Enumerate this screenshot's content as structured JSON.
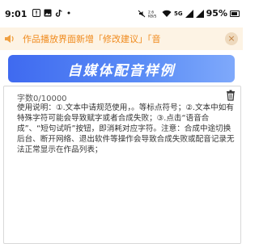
{
  "status_bar": {
    "time": "9:01",
    "left_icons": [
      "warning-icon",
      "image-icon",
      "tiktok-icon",
      "dot-icon"
    ],
    "network_label": "2.6\nKB/S",
    "signal_label": "5G",
    "battery_percent": "95%"
  },
  "notice": {
    "speaker_icon": "speaker-icon",
    "text": "作品播放界面新增「修改建议」「音",
    "close_symbol": "×"
  },
  "banner": {
    "title": "自媒体配音样例"
  },
  "editor": {
    "word_count": "字数0/10000",
    "instructions": "使用说明：①.文本中请规范使用，。等标点符号；②.文本中如有特殊字符可能会导致赋字或者合成失败；③.点击“语音合成”、“短句试听”按钮，即消耗对应字符。注意：合成中途切换后台、断开网络、退出软件等操作会导致合成失败或配音记录无法正常显示在作品列表；"
  }
}
